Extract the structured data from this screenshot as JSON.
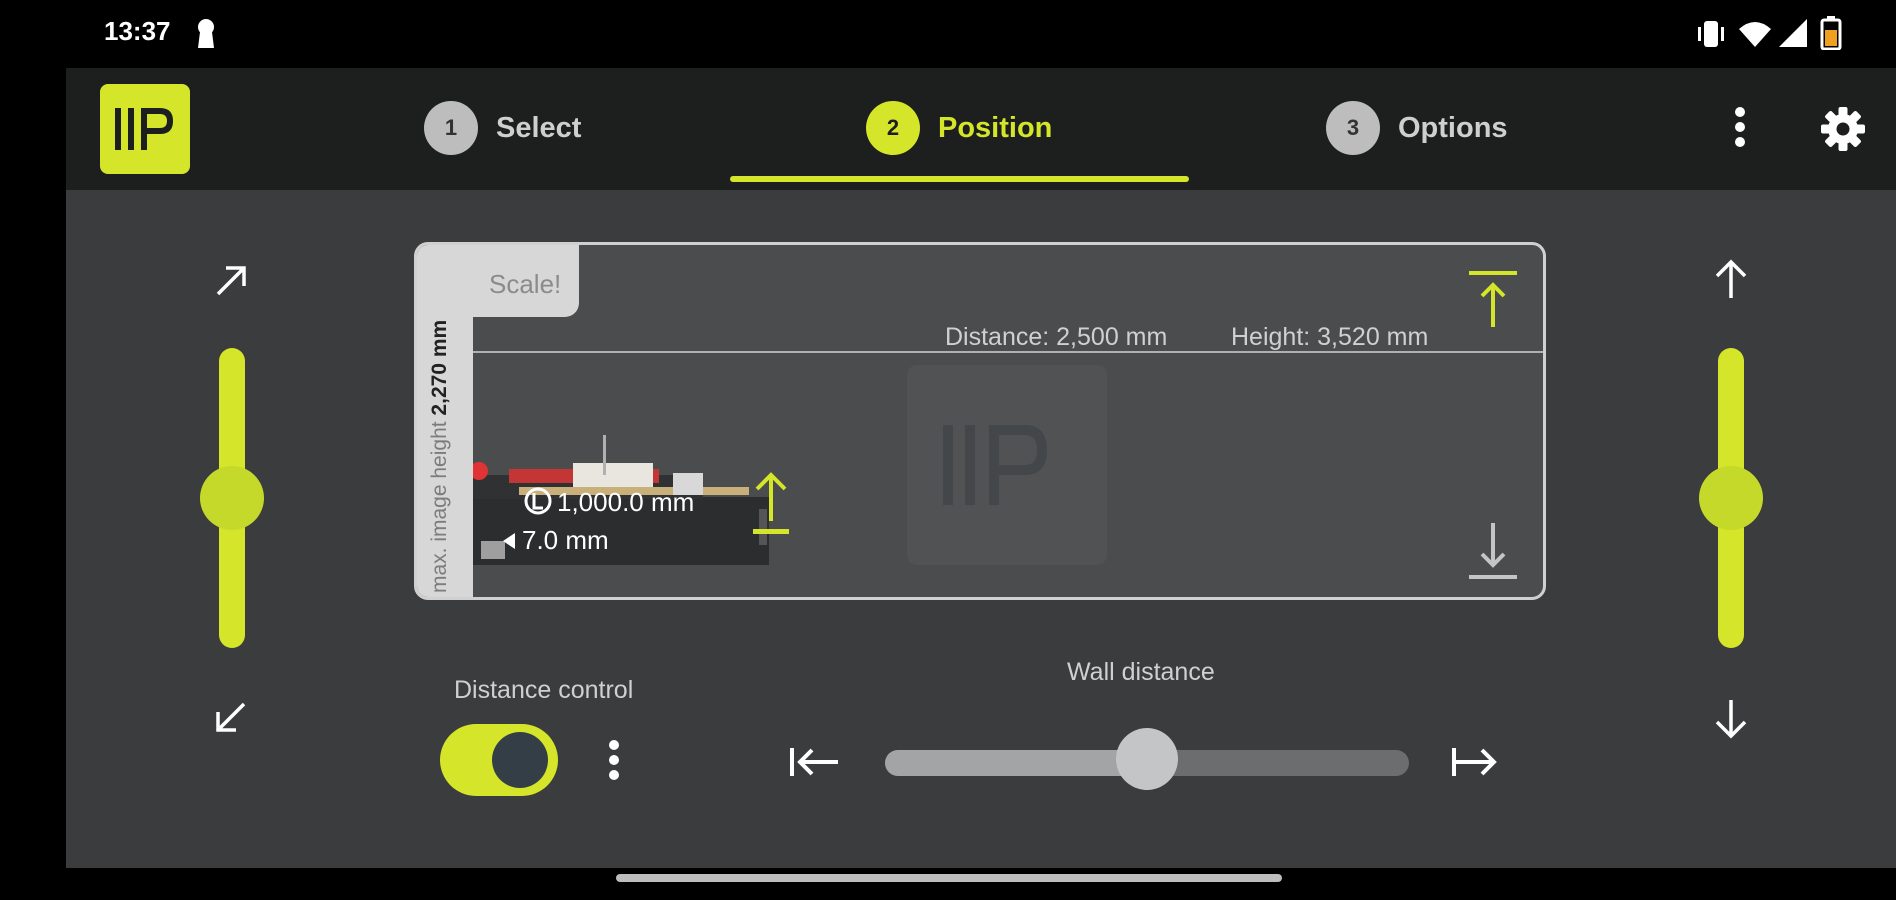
{
  "status_bar": {
    "time": "13:37",
    "icons": [
      "keyhole-icon",
      "vibrate-icon",
      "wifi-icon",
      "signal-icon",
      "battery-icon"
    ]
  },
  "app": {
    "logo_text": "IIP",
    "accent_color": "#d4e52a"
  },
  "steps": [
    {
      "number": "1",
      "label": "Select",
      "active": false
    },
    {
      "number": "2",
      "label": "Position",
      "active": true
    },
    {
      "number": "3",
      "label": "Options",
      "active": false
    }
  ],
  "toolbar_icons": [
    "more-vertical-icon",
    "gear-icon"
  ],
  "preview": {
    "scale_label": "Scale!",
    "vertical_label_prefix": "max. image height ",
    "vertical_label_value": "2,270 mm",
    "distance_text": "Distance: 2,500 mm",
    "height_text": "Height: 3,520 mm",
    "spec_throw": "1,000.0 mm",
    "spec_offset": "7.0 mm",
    "watermark": "IIP"
  },
  "left_slider": {
    "value": 0.5,
    "top_icon": "expand-arrow-icon",
    "bottom_icon": "collapse-arrow-icon"
  },
  "right_slider": {
    "value": 0.5,
    "top_icon": "arrow-up-icon",
    "bottom_icon": "arrow-down-icon"
  },
  "distance_control": {
    "label": "Distance control",
    "enabled": true
  },
  "wall_distance": {
    "label": "Wall distance",
    "value": 0.5
  }
}
